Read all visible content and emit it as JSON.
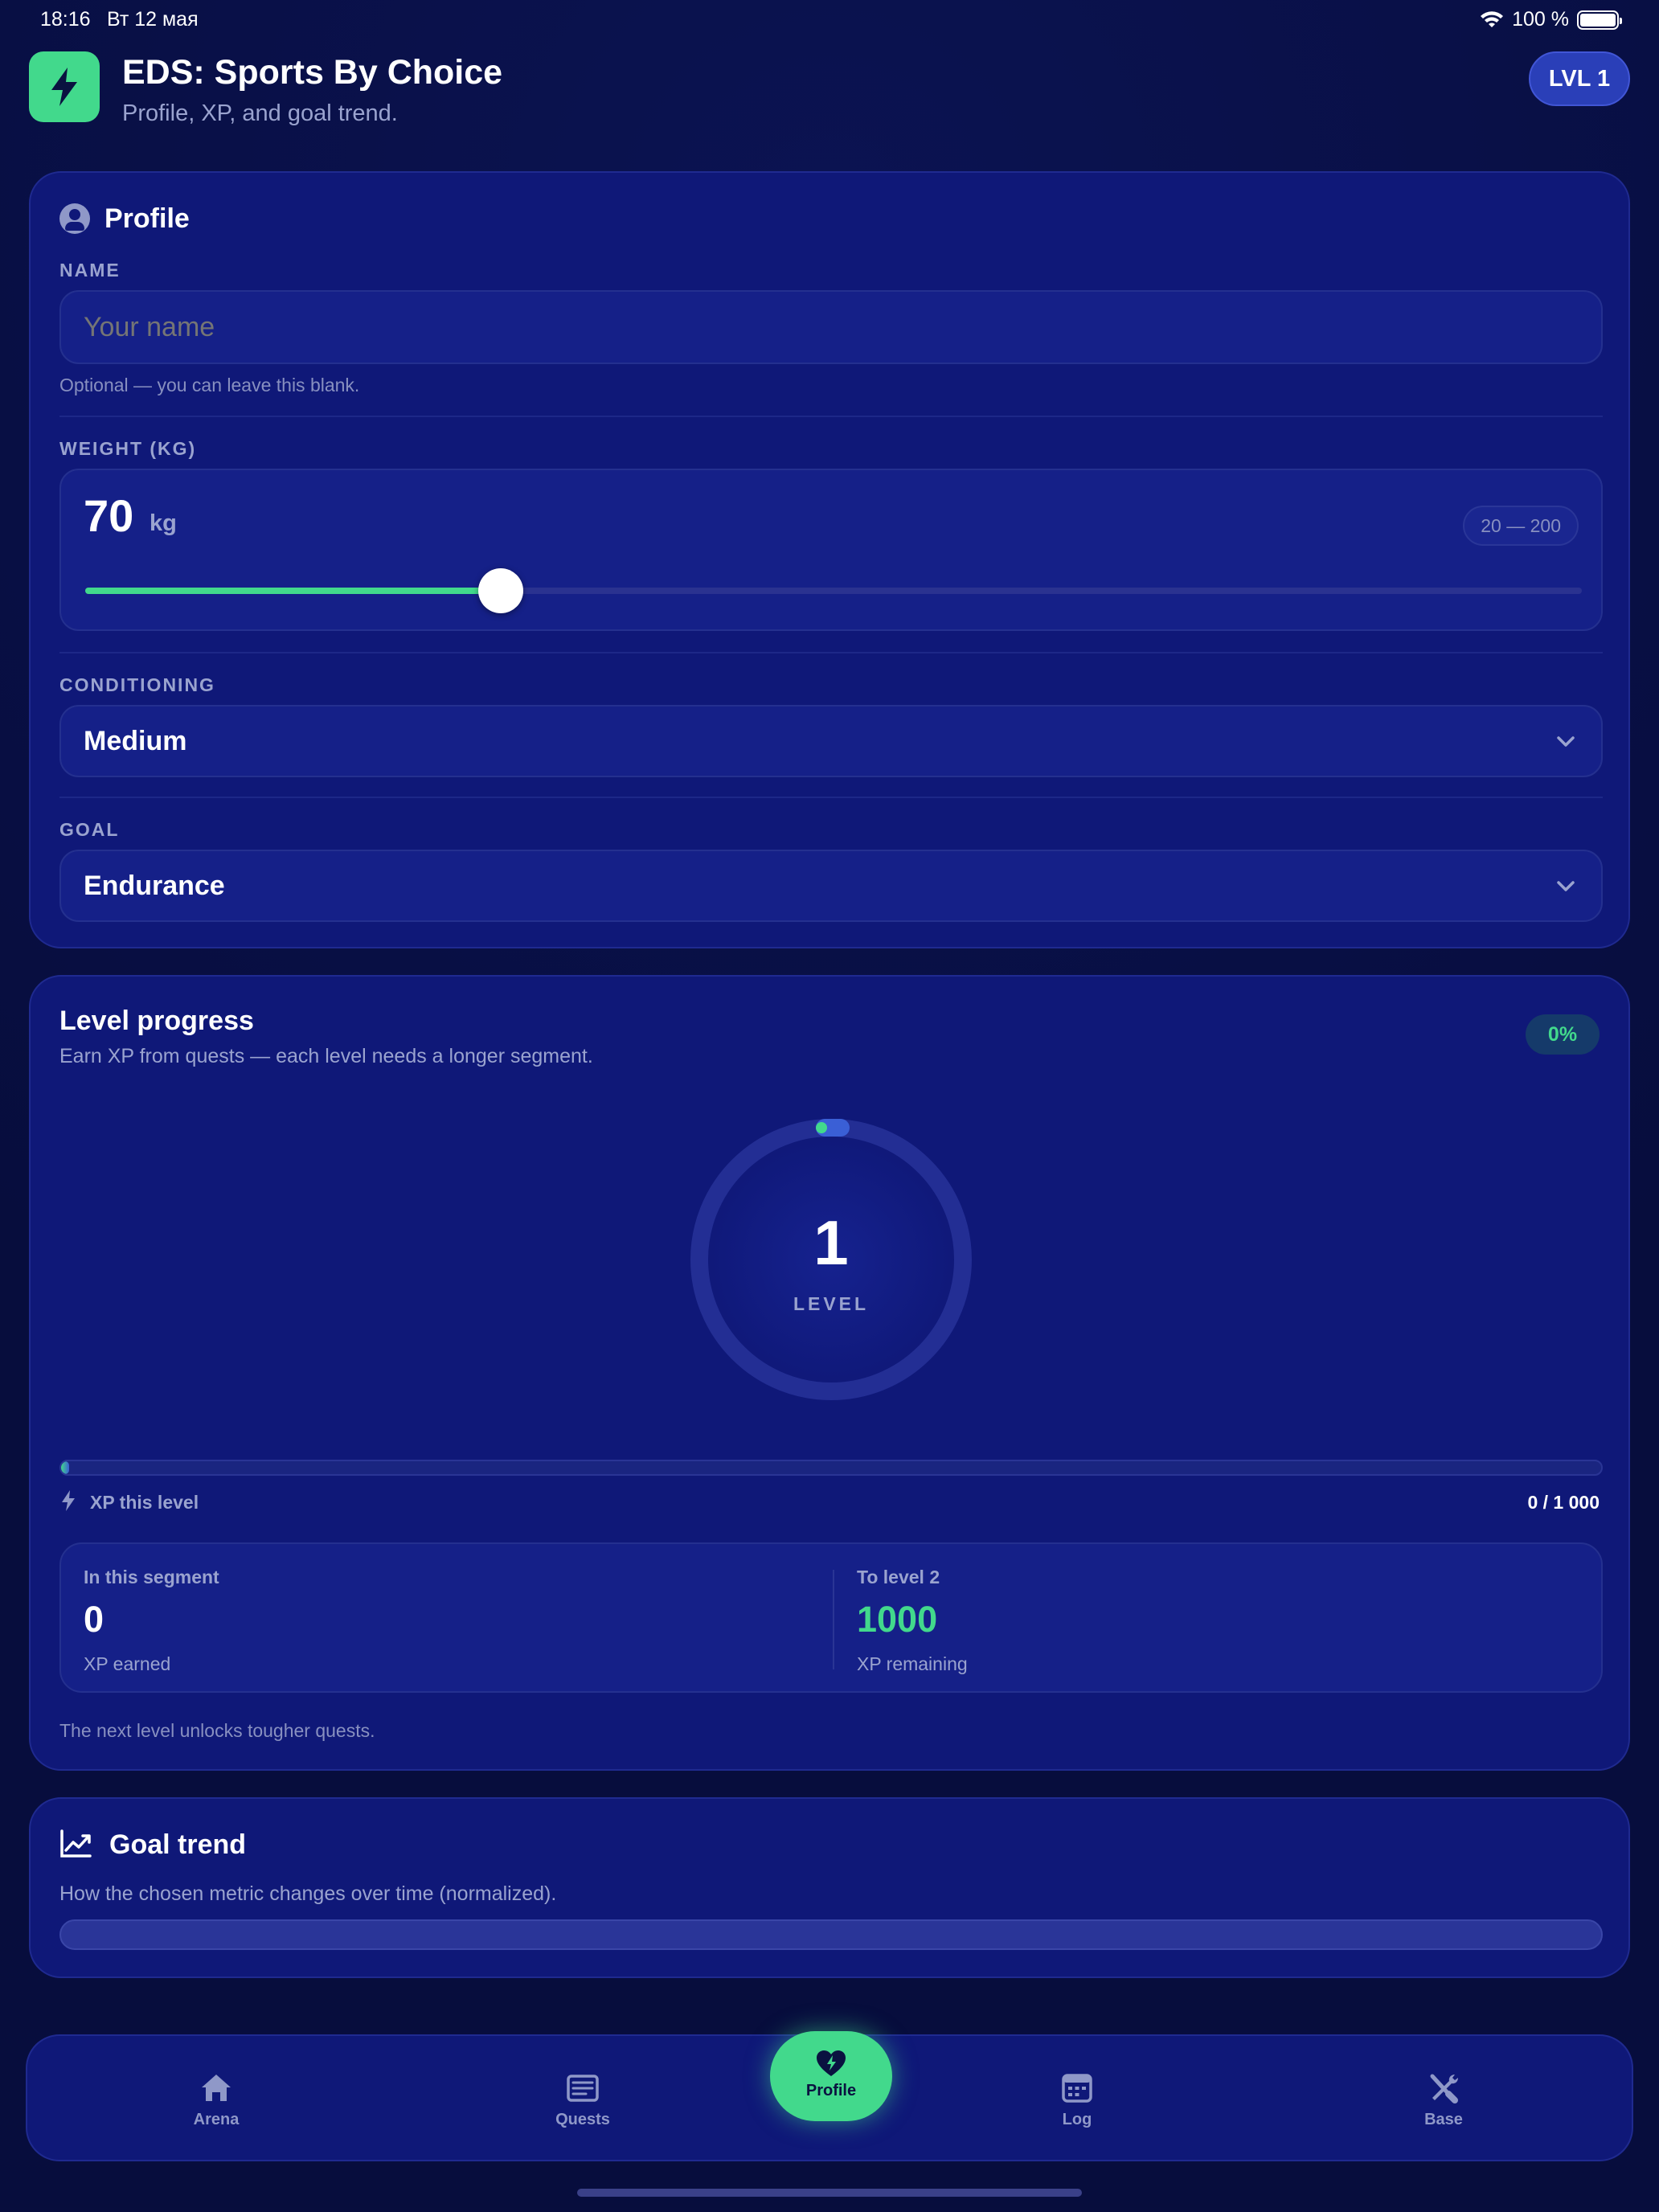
{
  "status_bar": {
    "time": "18:16",
    "date": "Вт 12 мая",
    "battery": "100 %"
  },
  "header": {
    "title": "EDS: Sports By Choice",
    "subtitle": "Profile, XP, and goal trend.",
    "level_badge": "LVL 1"
  },
  "profile": {
    "title": "Profile",
    "name": {
      "label": "NAME",
      "placeholder": "Your name",
      "value": "",
      "hint": "Optional — you can leave this blank."
    },
    "weight": {
      "label": "WEIGHT (KG)",
      "value": "70",
      "unit": "kg",
      "range": "20 — 200",
      "min": 20,
      "max": 200,
      "current": 70
    },
    "conditioning": {
      "label": "CONDITIONING",
      "value": "Medium"
    },
    "goal": {
      "label": "GOAL",
      "value": "Endurance"
    }
  },
  "level_progress": {
    "title": "Level progress",
    "subtitle": "Earn XP from quests — each level needs a longer segment.",
    "percent": "0%",
    "level": "1",
    "level_label": "LEVEL",
    "xp_label": "XP this level",
    "xp_value": "0 / 1 000",
    "xp_fraction": 0,
    "segment": {
      "title": "In this segment",
      "value": "0",
      "sub": "XP earned"
    },
    "next": {
      "title": "To level 2",
      "value": "1000",
      "sub": "XP remaining"
    },
    "footer": "The next level unlocks tougher quests."
  },
  "goal_trend": {
    "title": "Goal trend",
    "subtitle": "How the chosen metric changes over time (normalized)."
  },
  "tabs": [
    {
      "label": "Arena",
      "icon": "home-icon"
    },
    {
      "label": "Quests",
      "icon": "list-icon"
    },
    {
      "label": "Profile",
      "icon": "heart-bolt-icon",
      "active": true
    },
    {
      "label": "Log",
      "icon": "calendar-icon"
    },
    {
      "label": "Base",
      "icon": "tools-icon"
    }
  ],
  "colors": {
    "accent": "#42d98c",
    "card": "#0f1878",
    "background": "#070d3d",
    "badge": "#2a3fb8"
  }
}
